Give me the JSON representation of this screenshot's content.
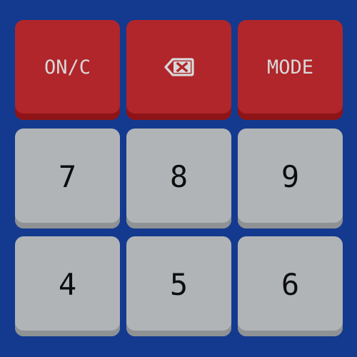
{
  "keypad": {
    "rows": [
      [
        {
          "label": "ON/C"
        },
        {
          "label": "",
          "icon": "backspace-icon"
        },
        {
          "label": "MODE"
        }
      ],
      [
        {
          "label": "7"
        },
        {
          "label": "8"
        },
        {
          "label": "9"
        }
      ],
      [
        {
          "label": "4"
        },
        {
          "label": "5"
        },
        {
          "label": "6"
        }
      ]
    ]
  },
  "colors": {
    "background": "#133a8f",
    "function_key": "#b0262b",
    "function_key_shadow": "#8e1417",
    "function_label": "#d8d8d8",
    "digit_key": "#b1b4b6",
    "digit_key_shadow": "#8f9294",
    "digit_label": "#0d0d0d"
  }
}
